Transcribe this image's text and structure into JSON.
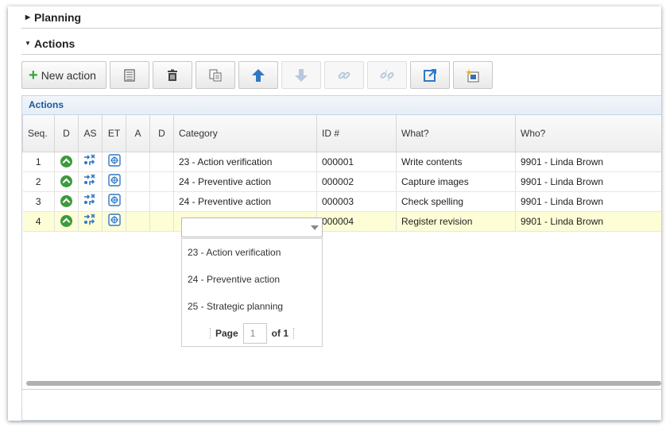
{
  "sections": {
    "planning": {
      "label": "Planning",
      "state": "collapsed"
    },
    "actions": {
      "label": "Actions",
      "state": "expanded"
    }
  },
  "toolbar": {
    "new_action_label": "New action",
    "buttons": [
      {
        "icon": "list-icon",
        "enabled": true
      },
      {
        "icon": "trash-icon",
        "enabled": true
      },
      {
        "icon": "copy-icon",
        "enabled": true
      },
      {
        "icon": "arrow-up-icon",
        "enabled": true
      },
      {
        "icon": "arrow-down-icon",
        "enabled": false
      },
      {
        "icon": "link-icon",
        "enabled": false
      },
      {
        "icon": "unlink-icon",
        "enabled": false
      },
      {
        "icon": "external-link-icon",
        "enabled": true
      },
      {
        "icon": "new-item-icon",
        "enabled": true
      }
    ]
  },
  "grid": {
    "title": "Actions",
    "columns": [
      "Seq.",
      "D",
      "AS",
      "ET",
      "A",
      "D",
      "Category",
      "ID #",
      "What?",
      "Who?"
    ],
    "rows": [
      {
        "seq": "1",
        "category": "23 - Action verification",
        "id": "000001",
        "what": "Write contents",
        "who": "9901 - Linda Brown"
      },
      {
        "seq": "2",
        "category": "24 - Preventive action",
        "id": "000002",
        "what": "Capture images",
        "who": "9901 - Linda Brown"
      },
      {
        "seq": "3",
        "category": "24 - Preventive action",
        "id": "000003",
        "what": "Check spelling",
        "who": "9901 - Linda Brown"
      },
      {
        "seq": "4",
        "category": "",
        "id": "000004",
        "what": "Register revision",
        "who": "9901 - Linda Brown"
      }
    ]
  },
  "category_dropdown": {
    "options": [
      "23 - Action verification",
      "24 - Preventive action",
      "25 - Strategic planning"
    ],
    "pager": {
      "page_label": "Page",
      "page_value": "1",
      "of_label": "of 1"
    }
  },
  "colors": {
    "accent": "#1a5aa0",
    "green": "#3c9a3c",
    "selected_row": "#fdfdd6",
    "icon_blue": "#2f78c4"
  }
}
